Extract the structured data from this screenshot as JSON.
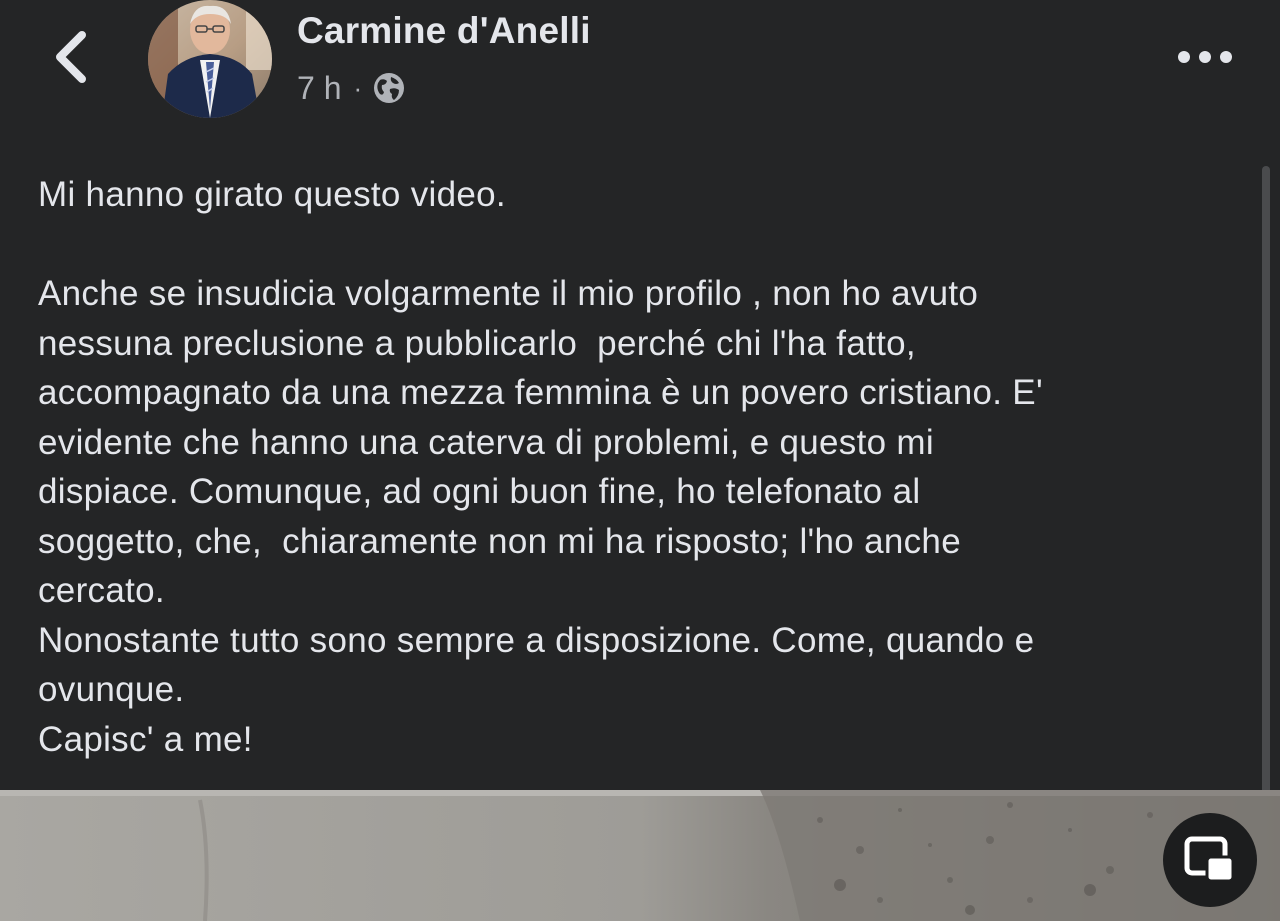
{
  "post": {
    "author_name": "Carmine d'Anelli",
    "timestamp": "7 h",
    "separator": "·",
    "privacy_icon": "globe-icon",
    "paragraphs": [
      "Mi hanno girato questo video.",
      "Anche se insudicia volgarmente il mio profilo , non ho avuto\nnessuna preclusione a pubblicarlo  perché chi l'ha fatto,\naccompagnato da una mezza femmina è un povero cristiano. E'\nevidente che hanno una caterva di problemi, e questo mi\ndispiace. Comunque, ad ogni buon fine, ho telefonato al\nsoggetto, che,  chiaramente non mi ha risposto; l'ho anche\ncercato.\nNonostante tutto sono sempre a disposizione. Come, quando e\novunque.\nCapisc' a me!"
    ]
  },
  "header": {
    "back_icon": "chevron-left-icon",
    "more_icon": "more-horizontal-icon"
  },
  "media": {
    "pip_icon": "picture-in-picture-icon"
  },
  "colors": {
    "background": "#242526",
    "primary_text": "#e4e6eb",
    "secondary_text": "#b0b3b8"
  }
}
